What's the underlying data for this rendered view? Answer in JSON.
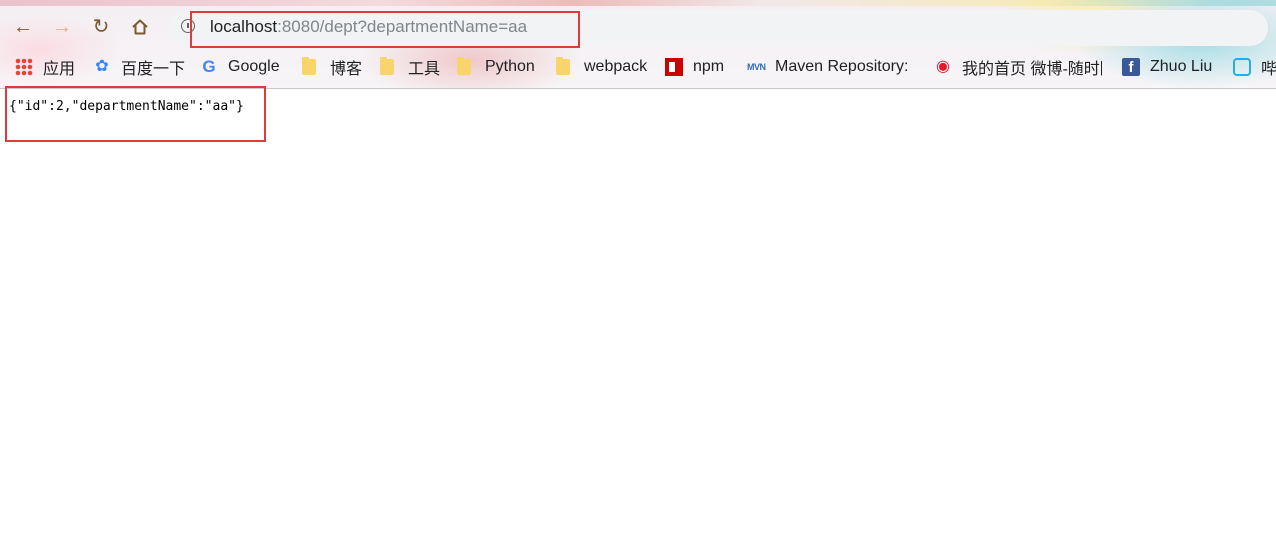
{
  "browser": {
    "nav": {
      "back_icon": "arrow-left-icon",
      "forward_icon": "arrow-right-icon",
      "reload_icon": "reload-icon",
      "home_icon": "home-icon"
    },
    "address_bar": {
      "host": "localhost",
      "rest": ":8080/dept?departmentName=aa"
    },
    "bookmarks": [
      {
        "label": "应用",
        "icon": "apps-grid-icon"
      },
      {
        "label": "百度一下",
        "icon": "baidu-paw-icon"
      },
      {
        "label": "Google",
        "icon": "google-g-icon"
      },
      {
        "label": "博客",
        "icon": "folder-icon"
      },
      {
        "label": "工具",
        "icon": "folder-icon"
      },
      {
        "label": "Python",
        "icon": "folder-icon"
      },
      {
        "label": "webpack",
        "icon": "folder-icon"
      },
      {
        "label": "npm",
        "icon": "npm-icon"
      },
      {
        "label": "Maven Repository: S",
        "icon": "maven-icon"
      },
      {
        "label": "我的首页 微博-随时随",
        "icon": "weibo-icon"
      },
      {
        "label": "Zhuo Liu",
        "icon": "facebook-icon"
      },
      {
        "label": "哔",
        "icon": "bilibili-icon"
      }
    ]
  },
  "page": {
    "json_response": "{\"id\":2,\"departmentName\":\"aa\"}"
  },
  "colors": {
    "annotation_box": "#e03a3a",
    "nav_icon": "#7a5a2f"
  }
}
